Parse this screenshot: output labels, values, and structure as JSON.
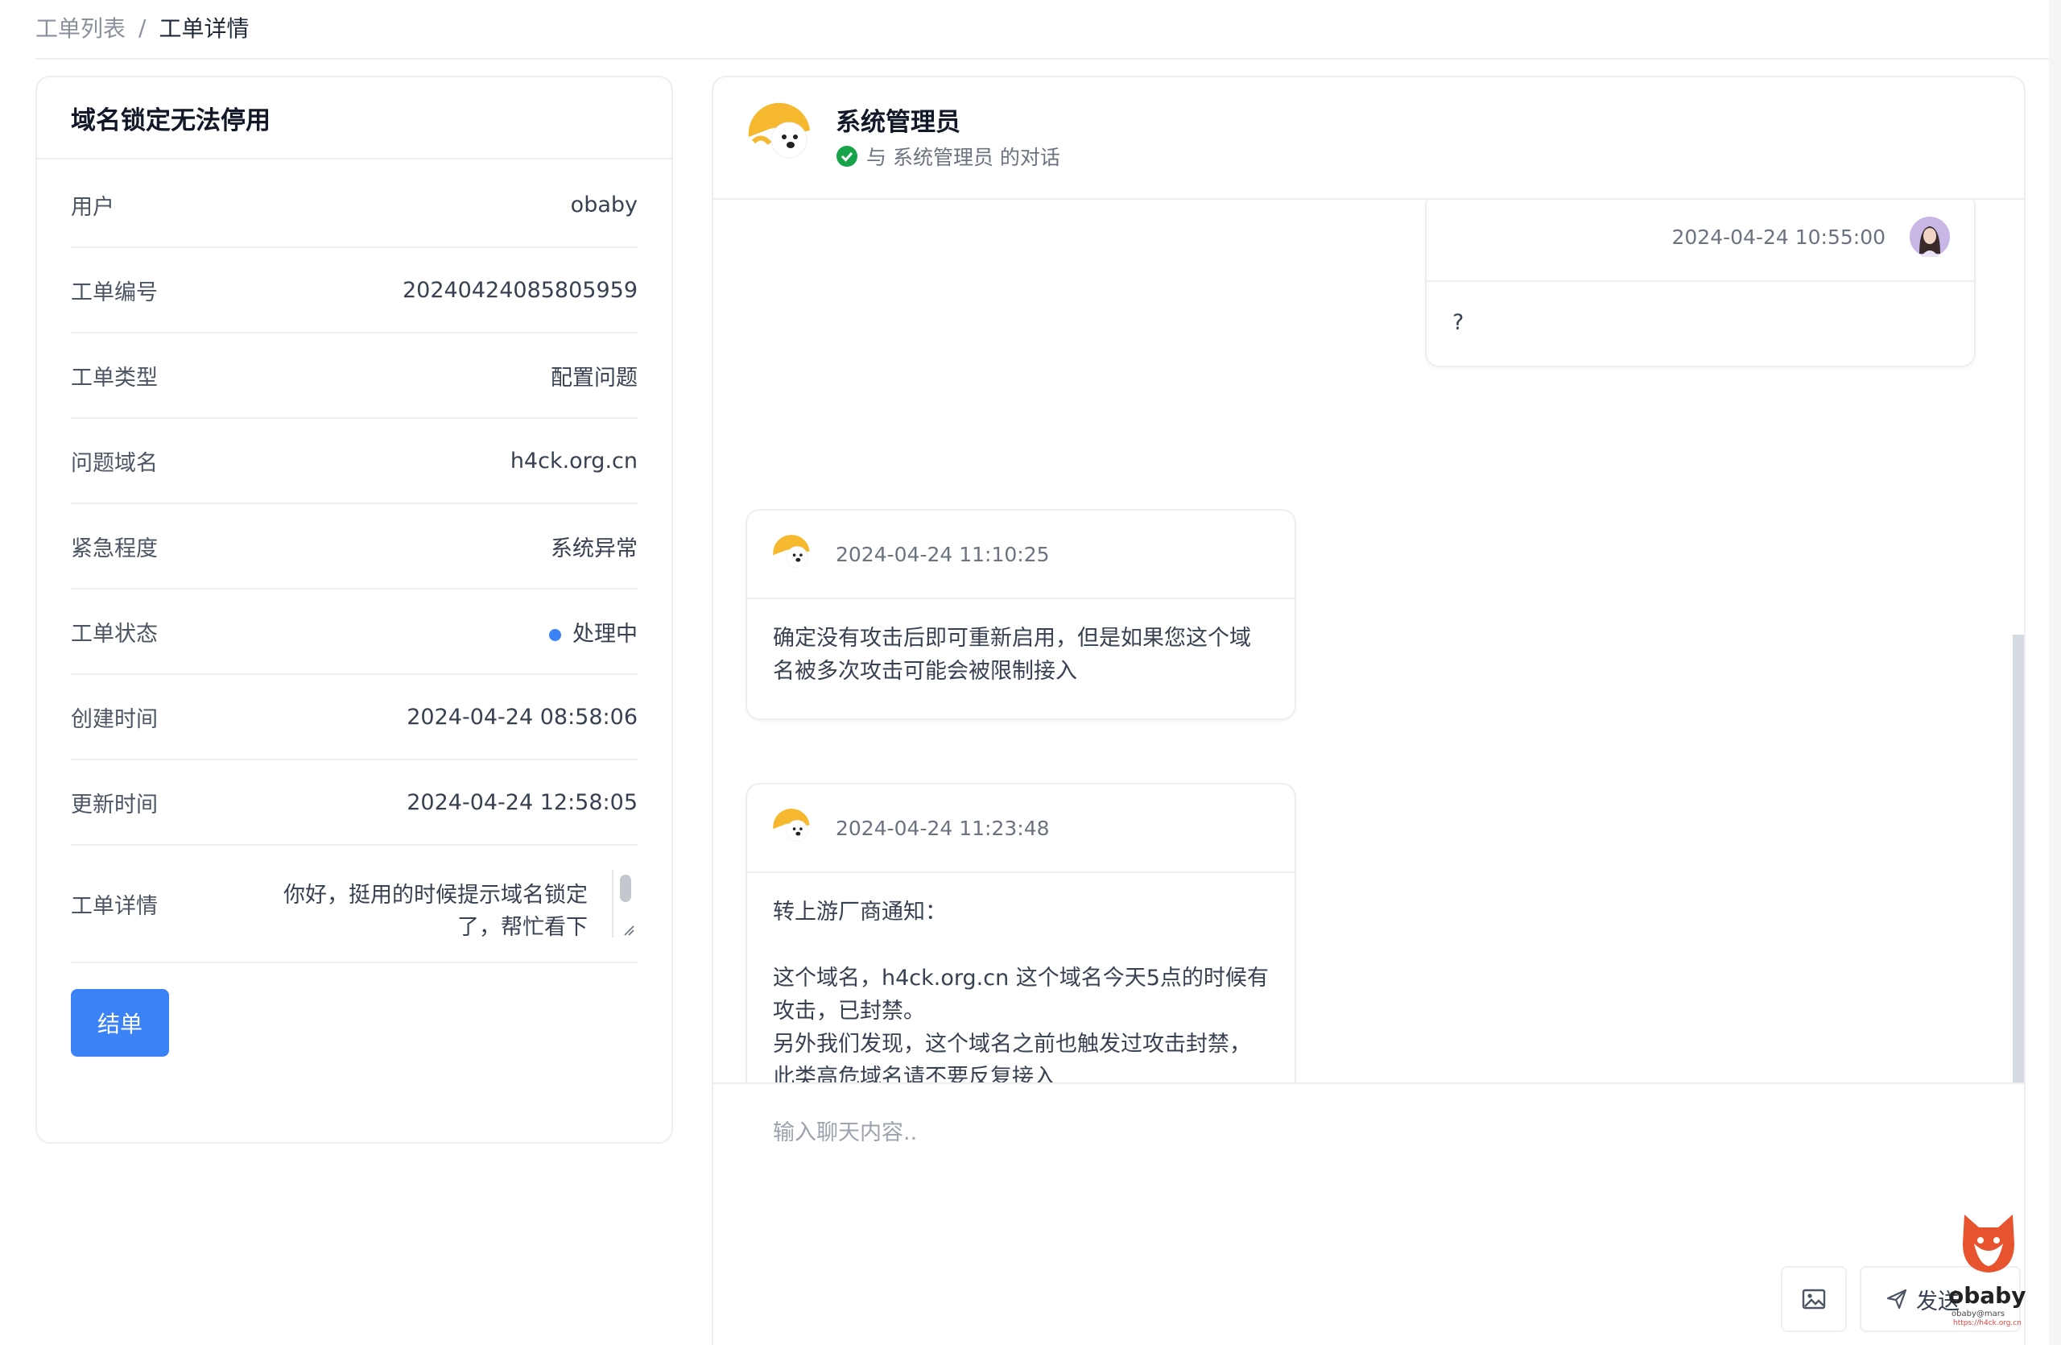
{
  "breadcrumb": {
    "parent": "工单列表",
    "separator": "/",
    "current": "工单详情"
  },
  "ticket": {
    "title": "域名锁定无法停用",
    "rows": [
      {
        "label": "用户",
        "value": "obaby"
      },
      {
        "label": "工单编号",
        "value": "20240424085805959"
      },
      {
        "label": "工单类型",
        "value": "配置问题"
      },
      {
        "label": "问题域名",
        "value": "h4ck.org.cn"
      },
      {
        "label": "紧急程度",
        "value": "系统异常"
      },
      {
        "label": "工单状态",
        "value": "处理中"
      },
      {
        "label": "创建时间",
        "value": "2024-04-24 08:58:06"
      },
      {
        "label": "更新时间",
        "value": "2024-04-24 12:58:05"
      }
    ],
    "detail_label": "工单详情",
    "detail_text": "你好，挺用的时候提示域名锁定了，帮忙看下",
    "close_button": "结单",
    "status_color": "#3b82f6"
  },
  "chat": {
    "name": "系统管理员",
    "subtitle": "与 系统管理员 的对话",
    "messages": [
      {
        "time": "2024-04-24 10:55:00",
        "text": "?"
      },
      {
        "time": "2024-04-24 11:10:25",
        "text": "确定没有攻击后即可重新启用，但是如果您这个域\n名被多次攻击可能会被限制接入"
      },
      {
        "time": "2024-04-24 11:23:48",
        "text": "转上游厂商通知：\n\n这个域名，h4ck.org.cn 这个域名今天5点的时候有\n攻击，已封禁。\n另外我们发现，这个域名之前也触发过攻击封禁，\n此类高危域名请不要反复接入"
      }
    ],
    "input_placeholder": "输入聊天内容..",
    "send_label": "发送",
    "accent": "#3b82f6"
  },
  "watermark": {
    "name": "obaby",
    "line1": "obaby@mars",
    "line2": "https://h4ck.org.cn"
  }
}
